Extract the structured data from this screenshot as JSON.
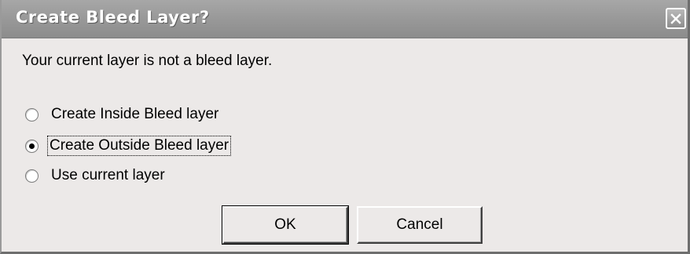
{
  "dialog": {
    "title": "Create Bleed Layer?",
    "message": "Your current layer is not a bleed layer.",
    "options": [
      {
        "label": "Create Inside Bleed layer",
        "checked": false
      },
      {
        "label": "Create Outside Bleed layer",
        "checked": true
      },
      {
        "label": "Use current layer",
        "checked": false
      }
    ],
    "buttons": {
      "ok_label": "OK",
      "cancel_label": "Cancel"
    }
  },
  "icons": {
    "close": "close-icon"
  },
  "colors": {
    "window_bg": "#ece9e8",
    "titlebar": "#9a9a9a",
    "title_text": "#ffffff"
  }
}
